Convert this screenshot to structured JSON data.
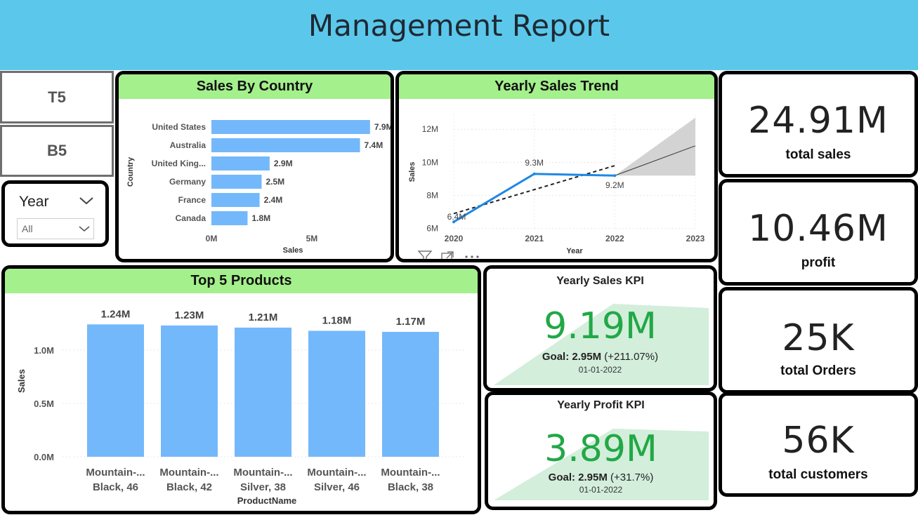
{
  "header": {
    "title": "Management Report"
  },
  "buttons": {
    "top5": "T5",
    "bottom5": "B5"
  },
  "year_slicer": {
    "label": "Year",
    "selected": "All"
  },
  "colors": {
    "header_bg": "#5bc8eb",
    "card_head_bg": "#a4f08c",
    "bar": "#74b8fc",
    "kpi_green": "#21a846",
    "kpi_area": "#d3eedb",
    "line": "#1e88e5"
  },
  "icons": [
    "chevron-down-icon",
    "filter-icon",
    "focus-mode-icon",
    "more-options-icon"
  ],
  "kpi_cards": [
    {
      "value": "24.91M",
      "label": "total sales"
    },
    {
      "value": "10.46M",
      "label": "profit"
    },
    {
      "value": "25K",
      "label": "total Orders"
    },
    {
      "value": "56K",
      "label": "total customers"
    }
  ],
  "sales_kpi": {
    "title": "Yearly Sales KPI",
    "value": "9.19M",
    "goal_label": "Goal: 2.95M",
    "goal_delta": "(+211.07%)",
    "date": "01-01-2022"
  },
  "profit_kpi": {
    "title": "Yearly Profit KPI",
    "value": "3.89M",
    "goal_label": "Goal: 2.95M",
    "goal_delta": "(+31.7%)",
    "date": "01-01-2022"
  },
  "chart_data": [
    {
      "type": "bar",
      "orientation": "horizontal",
      "title": "Sales By Country",
      "xlabel": "Sales",
      "ylabel": "Country",
      "categories": [
        "United States",
        "Australia",
        "United King...",
        "Germany",
        "France",
        "Canada"
      ],
      "values": [
        7.9,
        7.4,
        2.9,
        2.5,
        2.4,
        1.8
      ],
      "data_labels": [
        "7.9M",
        "7.4M",
        "2.9M",
        "2.5M",
        "2.4M",
        "1.8M"
      ],
      "x_ticks": [
        "0M",
        "5M"
      ],
      "xlim": [
        0,
        8.5
      ],
      "units": "M"
    },
    {
      "type": "line",
      "title": "Yearly Sales Trend",
      "xlabel": "Year",
      "ylabel": "Sales",
      "x": [
        2020,
        2021,
        2022
      ],
      "values": [
        6.4,
        9.3,
        9.2
      ],
      "data_labels": [
        "6.4M",
        "9.3M",
        "9.2M"
      ],
      "x_ticks": [
        "2020",
        "2021",
        "2022",
        "2023"
      ],
      "y_ticks": [
        "6M",
        "8M",
        "10M",
        "12M"
      ],
      "ylim": [
        5.9,
        12.9
      ],
      "trend_line": {
        "x": [
          2020,
          2022
        ],
        "values": [
          6.9,
          9.8
        ]
      },
      "forecast": {
        "x": [
          2022,
          2023
        ],
        "values": [
          9.2,
          11.0
        ],
        "upper": [
          9.2,
          12.7
        ],
        "lower": [
          9.2,
          9.2
        ]
      }
    },
    {
      "type": "bar",
      "title": "Top 5 Products",
      "xlabel": "ProductName",
      "ylabel": "Sales",
      "categories": [
        "Mountain-... Black, 46",
        "Mountain-... Black, 42",
        "Mountain-... Silver, 38",
        "Mountain-... Silver, 46",
        "Mountain-... Black, 38"
      ],
      "category_lines": [
        [
          "Mountain-...",
          "Black, 46"
        ],
        [
          "Mountain-...",
          "Black, 42"
        ],
        [
          "Mountain-...",
          "Silver, 38"
        ],
        [
          "Mountain-...",
          "Silver, 46"
        ],
        [
          "Mountain-...",
          "Black, 38"
        ]
      ],
      "values": [
        1.24,
        1.23,
        1.21,
        1.18,
        1.17
      ],
      "data_labels": [
        "1.24M",
        "1.23M",
        "1.21M",
        "1.18M",
        "1.17M"
      ],
      "y_ticks": [
        "0.0M",
        "0.5M",
        "1.0M"
      ],
      "ylim": [
        0,
        1.4
      ],
      "units": "M"
    }
  ]
}
